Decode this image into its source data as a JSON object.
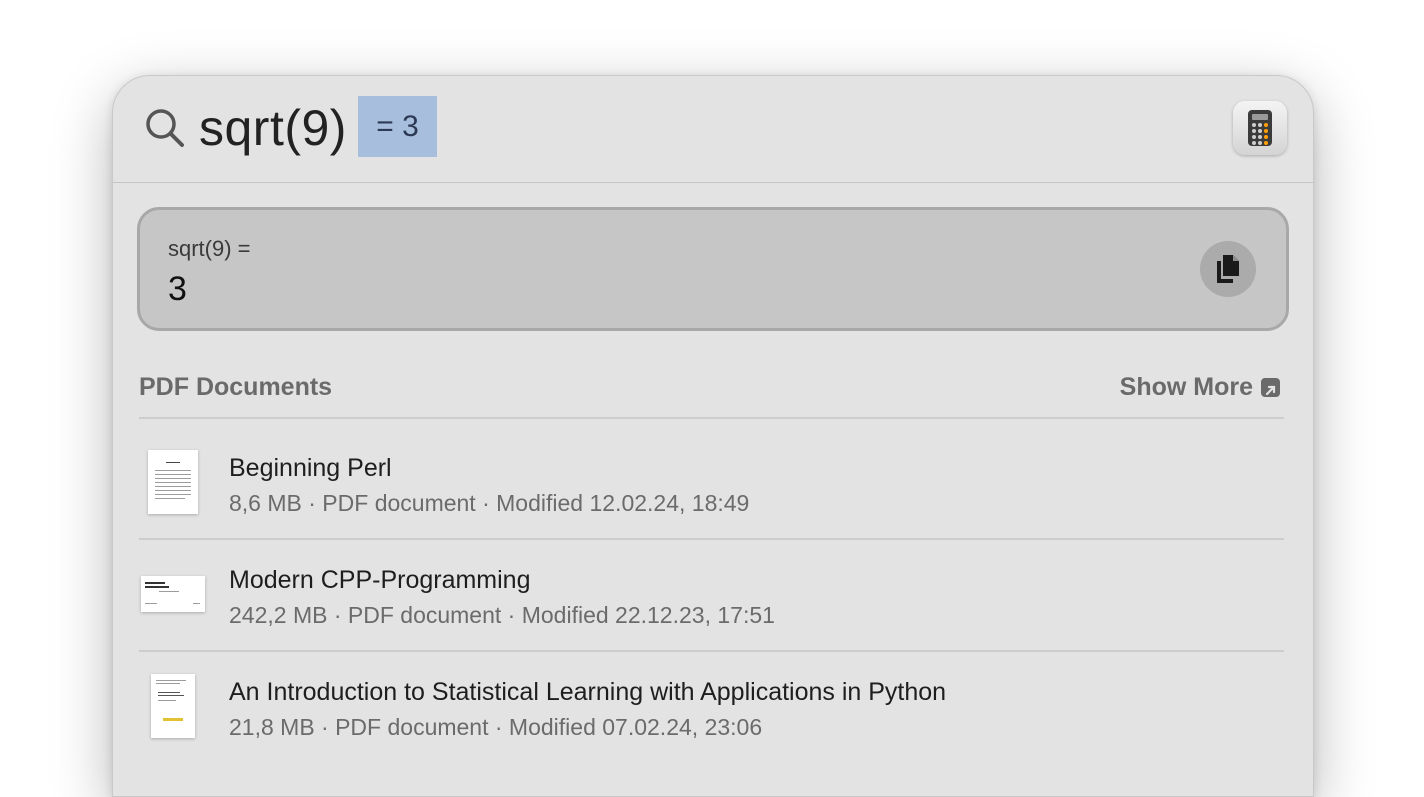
{
  "search": {
    "query": "sqrt(9)",
    "inline_answer": "= 3"
  },
  "calculator": {
    "expression": "sqrt(9) =",
    "result": "3"
  },
  "section": {
    "title": "PDF Documents",
    "show_more_label": "Show More"
  },
  "results": [
    {
      "title": "Beginning Perl",
      "meta": "8,6 MB · PDF document · Modified 12.02.24, 18:49"
    },
    {
      "title": "Modern CPP-Programming",
      "meta": "242,2 MB · PDF document · Modified 22.12.23, 17:51"
    },
    {
      "title": "An Introduction to Statistical Learning with Applications in Python",
      "meta": "21,8 MB · PDF document · Modified 07.02.24, 23:06"
    }
  ],
  "icons": {
    "search": "magnifying-glass-icon",
    "app": "calculator-app-icon",
    "copy": "copy-documents-icon",
    "show_more": "arrow-up-right-square-icon",
    "file_thumbnail": "pdf-thumbnail-icon"
  },
  "colors": {
    "window_bg": "#e3e3e3",
    "selection_highlight": "#a8bedd",
    "result_card_bg": "#c6c6c6",
    "secondary_text": "#6b6b6b"
  }
}
